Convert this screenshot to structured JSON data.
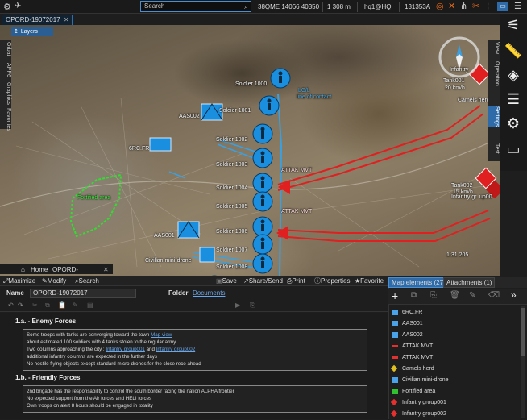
{
  "topbar": {
    "search_placeholder": "Search",
    "coords": "38QME 14066 40350",
    "altitude": "1 308 m",
    "hq": "hq1@HQ",
    "time": "131353A"
  },
  "tabs": {
    "document": "OPORD-19072017"
  },
  "map": {
    "layers_label": "Layers",
    "left_tabs": [
      "Orbat",
      "APP6",
      "Graphics",
      "Favorites"
    ],
    "right_tabs": [
      "View",
      "Operation",
      "Settings",
      "Test"
    ],
    "scale": "1:31 205",
    "labels": {
      "soldier1000": "Soldier 1000",
      "soldier1001": "Soldier 1001",
      "soldier1002": "Soldier 1002",
      "soldier1003": "Soldier 1003",
      "soldier1004": "Soldier 1004",
      "soldier1005": "Soldier 1005",
      "soldier1006": "Soldier 1006",
      "soldier1007": "Soldier 1007",
      "soldier1008": "Soldier 1008",
      "aas002": "AAS002",
      "aas001": "AAS001",
      "rcfr": "6RC.FR",
      "civ": "Civilian mini-drone",
      "attak1": "ATTAK MVT",
      "attak2": "ATTAK MVT",
      "lc1": "LC/L",
      "lc2": "line of contact",
      "tank1": "Tank001",
      "tank1_speed": "20 km/h",
      "camels": "Camels herd",
      "tank2": "Tank002",
      "tank2_speed": "15 km/h",
      "infantry_grp": "Infantry gr. up00",
      "fortified": "Fortified area",
      "infantry_label": "Infantry"
    }
  },
  "homebar": {
    "home": "Home",
    "tab": "OPORD-19072017"
  },
  "toolbar": {
    "maximize": "Maximize",
    "modify": "Modify",
    "search": "Search",
    "save": "Save",
    "share": "Share/Send",
    "print": "Print",
    "properties": "Properties",
    "favorite": "Favorite"
  },
  "form": {
    "name_label": "Name",
    "name_value": "OPORD-19072017",
    "folder_label": "Folder",
    "folder_value": "Documents"
  },
  "doc": {
    "sec1_title": "1.a. - Enemy Forces",
    "sec1_lines": [
      [
        "Some troops with tanks are converging toward the town ",
        "Map view"
      ],
      [
        "about estimated 100 soldiers with 4 tanks stolen to the regular army",
        ""
      ],
      [
        "Two columns approaching the city : ",
        "Infantry group001",
        " and ",
        "Infantry group002"
      ],
      [
        "additional infantry columns are expected in the further days",
        ""
      ],
      [
        "No hostile flying objects except standard micro-drones for the close reco ahead",
        ""
      ]
    ],
    "sec2_title": "1.b. - Friendly Forces",
    "sec2_lines": [
      "2nd brigade has the responsability to control the south border facing the nation ALPHA frontier",
      "No expected support from the Air forces and HELI forces",
      "Own troops on alert 8 hours should be engaged in totality"
    ]
  },
  "rpanel": {
    "tab_elements": "Map elements (27)",
    "tab_attachments": "Attachments (1)",
    "items": [
      {
        "label": "6RC.FR",
        "color": "#4aa3e8",
        "shape": "rect"
      },
      {
        "label": "AAS001",
        "color": "#4aa3e8",
        "shape": "rect"
      },
      {
        "label": "AAS002",
        "color": "#4aa3e8",
        "shape": "rect"
      },
      {
        "label": "ATTAK MVT",
        "color": "#e53030",
        "shape": "arrow"
      },
      {
        "label": "ATTAK MVT",
        "color": "#e53030",
        "shape": "arrow"
      },
      {
        "label": "Camels herd",
        "color": "#e0c020",
        "shape": "diamond"
      },
      {
        "label": "Civilian mini-drone",
        "color": "#4aa3e8",
        "shape": "rect"
      },
      {
        "label": "Fortified area",
        "color": "#30c030",
        "shape": "rect"
      },
      {
        "label": "Infantry group001",
        "color": "#e53030",
        "shape": "diamond"
      },
      {
        "label": "Infantry group002",
        "color": "#e53030",
        "shape": "diamond"
      }
    ]
  }
}
